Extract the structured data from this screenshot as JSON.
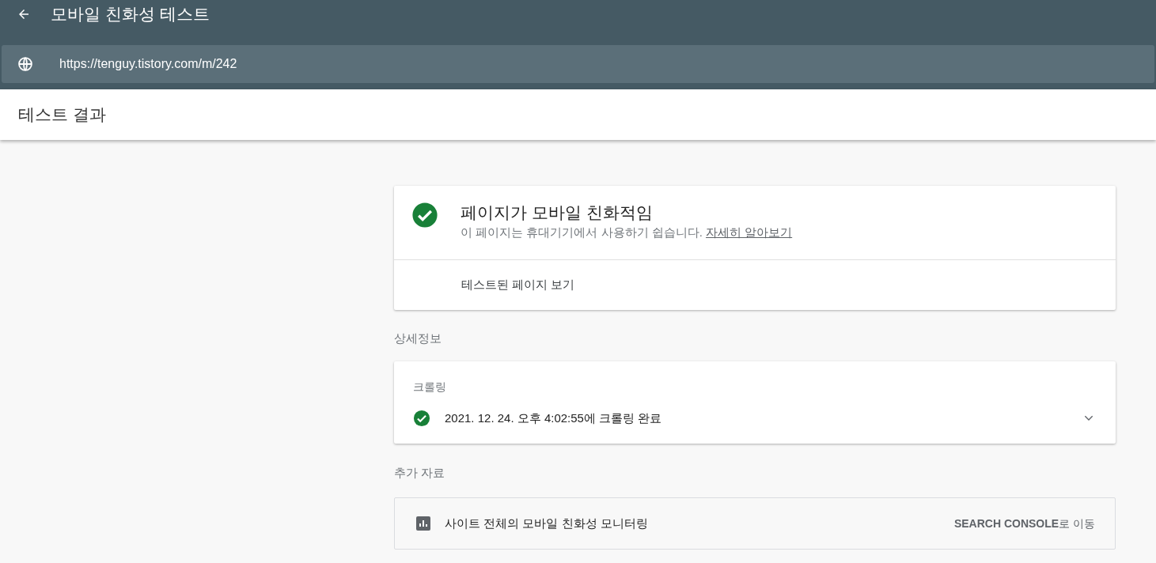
{
  "app_bar": {
    "title": "모바일 친화성 테스트"
  },
  "url_bar": {
    "value": "https://tenguy.tistory.com/m/242"
  },
  "section_bar": {
    "title": "테스트 결과"
  },
  "result_card": {
    "heading": "페이지가 모바일 친화적임",
    "description": "이 페이지는 휴대기기에서 사용하기 쉽습니다.",
    "link": "자세히 알아보기",
    "action": "테스트된 페이지 보기"
  },
  "details": {
    "heading": "상세정보",
    "card": {
      "label": "크롤링",
      "status": "2021. 12. 24. 오후 4:02:55에 크롤링 완료",
      "expanded": false
    }
  },
  "resources": {
    "heading": "추가 자료",
    "item": {
      "label": "사이트 전체의 모바일 친화성 모니터링",
      "link": "**SEARCH CONSOLE**로 이동"
    }
  }
}
